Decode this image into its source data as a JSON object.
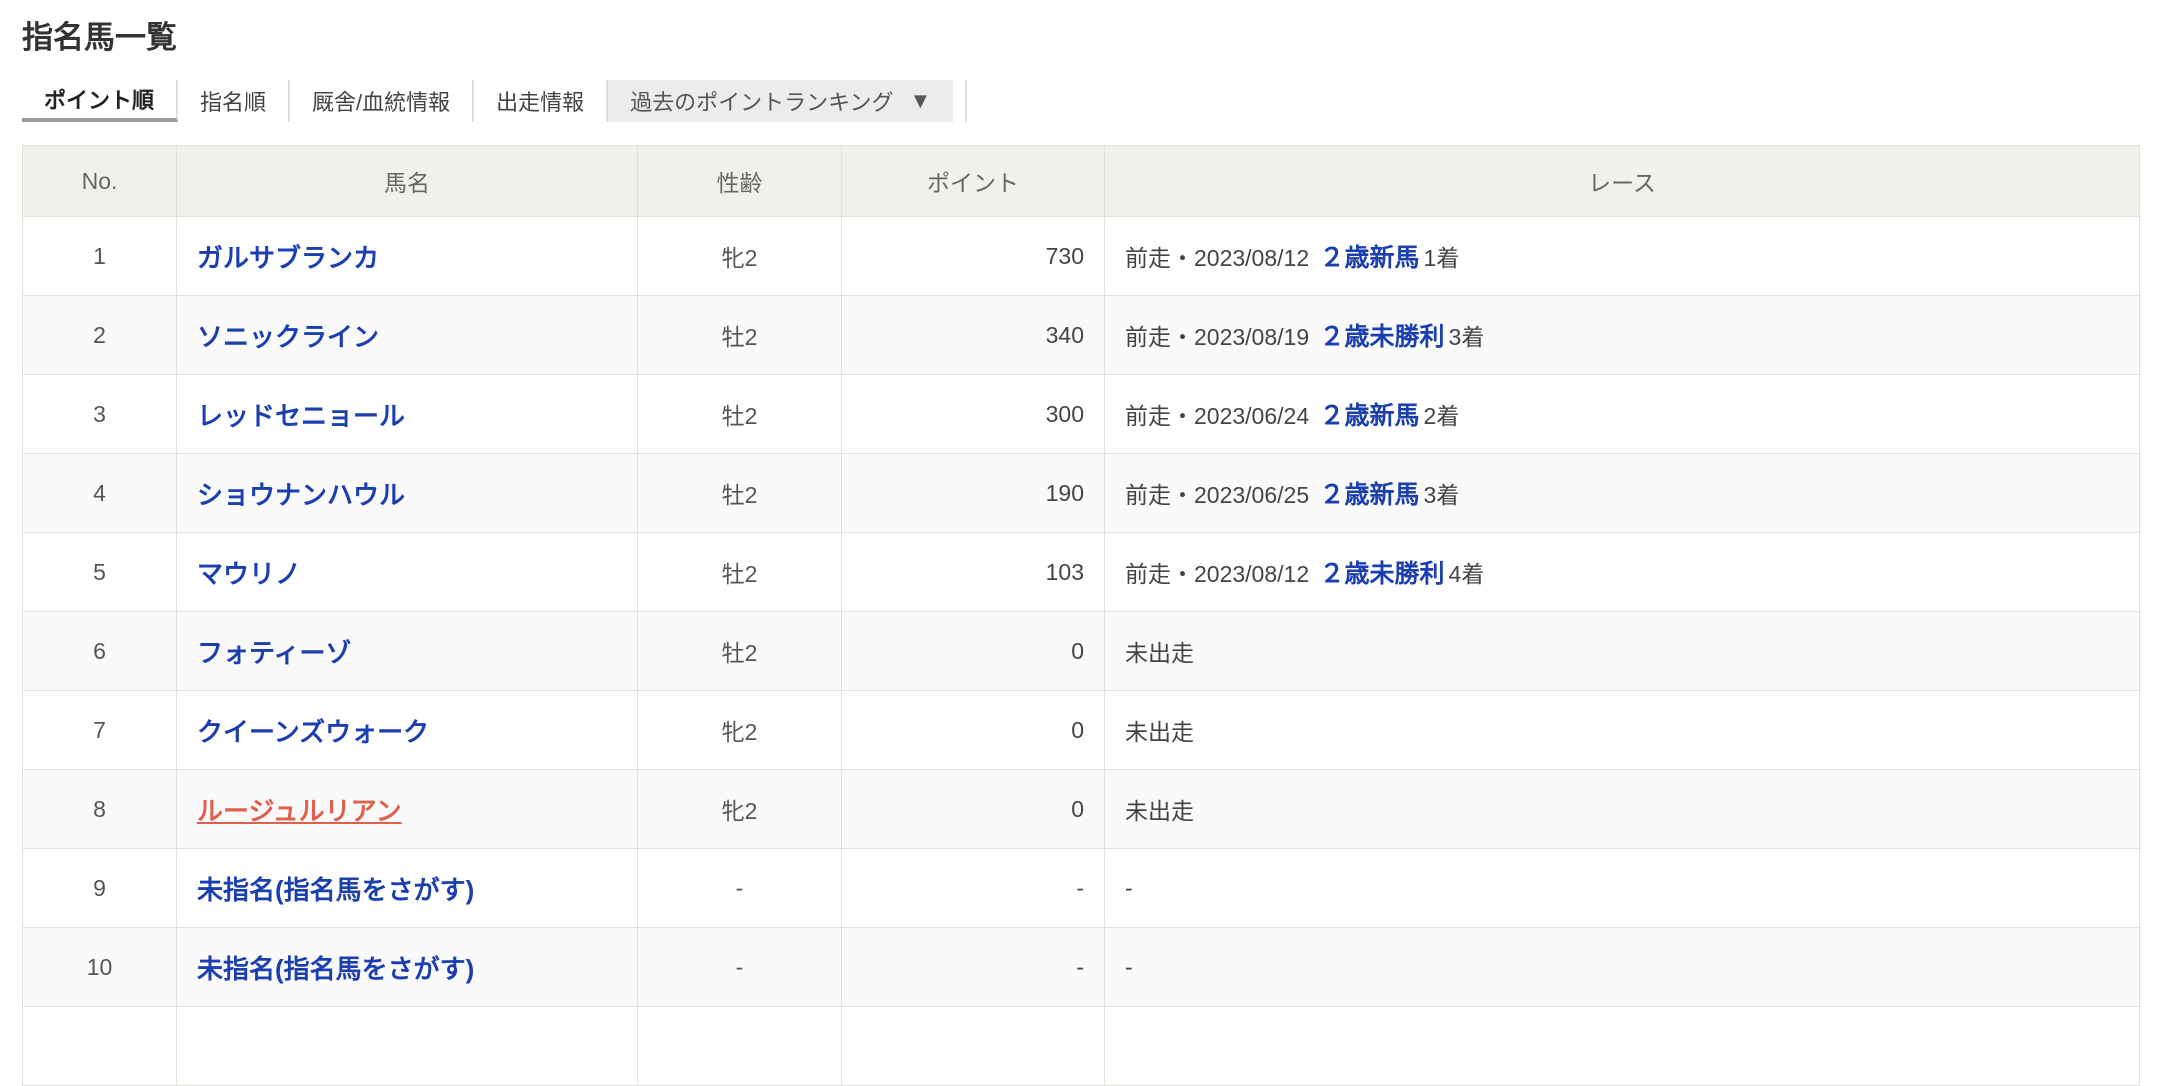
{
  "title": "指名馬一覧",
  "tabs": [
    {
      "label": "ポイント順",
      "active": true
    },
    {
      "label": "指名順"
    },
    {
      "label": "厩舎/血統情報"
    },
    {
      "label": "出走情報"
    },
    {
      "label": "過去のポイントランキング",
      "arrow": "▼"
    }
  ],
  "colors": {
    "link": "#1b3fae",
    "highlight_link": "#e0604e",
    "header_bg": "#f2f0ea"
  },
  "table": {
    "headers": [
      "No.",
      "馬名",
      "性齢",
      "ポイント",
      "レース"
    ],
    "rows": [
      {
        "no": "1",
        "name": "ガルサブランカ",
        "sex": "牝2",
        "points": "730",
        "prefix": "前走・2023/08/12",
        "race": "２歳新馬",
        "finish": "1着"
      },
      {
        "no": "2",
        "name": "ソニックライン",
        "sex": "牡2",
        "points": "340",
        "prefix": "前走・2023/08/19",
        "race": "２歳未勝利",
        "finish": "3着"
      },
      {
        "no": "3",
        "name": "レッドセニョール",
        "sex": "牡2",
        "points": "300",
        "prefix": "前走・2023/06/24",
        "race": "２歳新馬",
        "finish": "2着"
      },
      {
        "no": "4",
        "name": "ショウナンハウル",
        "sex": "牡2",
        "points": "190",
        "prefix": "前走・2023/06/25",
        "race": "２歳新馬",
        "finish": "3着"
      },
      {
        "no": "5",
        "name": "マウリノ",
        "sex": "牡2",
        "points": "103",
        "prefix": "前走・2023/08/12",
        "race": "２歳未勝利",
        "finish": "4着"
      },
      {
        "no": "6",
        "name": "フォティーゾ",
        "sex": "牡2",
        "points": "0",
        "prefix": "未出走"
      },
      {
        "no": "7",
        "name": "クイーンズウォーク",
        "sex": "牝2",
        "points": "0",
        "prefix": "未出走"
      },
      {
        "no": "8",
        "name": "ルージュルリアン",
        "sex": "牝2",
        "points": "0",
        "prefix": "未出走",
        "highlight": true
      },
      {
        "no": "9",
        "name": "未指名(指名馬をさがす)",
        "sex": "-",
        "points": "-",
        "prefix": "-"
      },
      {
        "no": "10",
        "name": "未指名(指名馬をさがす)",
        "sex": "-",
        "points": "-",
        "prefix": "-"
      }
    ]
  }
}
